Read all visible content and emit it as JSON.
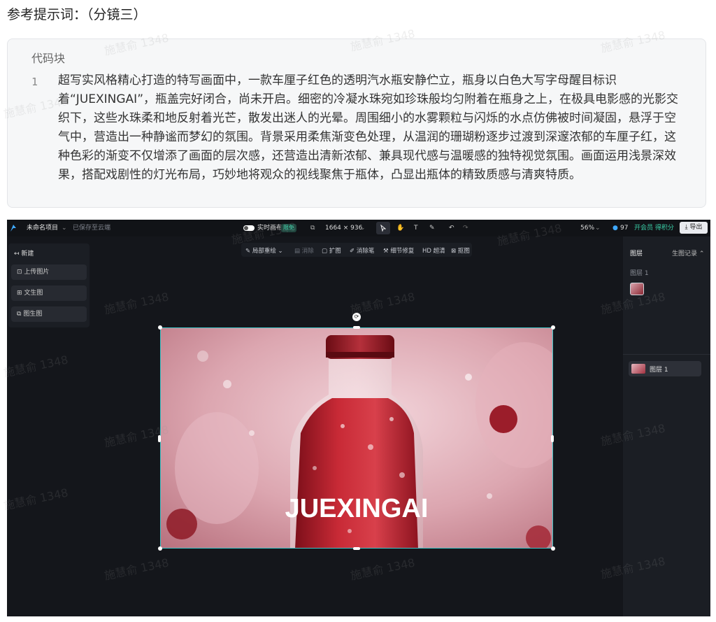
{
  "heading": "参考提示词：（分镜三）",
  "code_block": {
    "label": "代码块",
    "line_number": "1",
    "text": "超写实风格精心打造的特写画面中，一款车厘子红色的透明汽水瓶安静伫立，瓶身以白色大写字母醒目标识着“JUEXINGAI”，瓶盖完好闭合，尚未开启。细密的冷凝水珠宛如珍珠般均匀附着在瓶身之上，在极具电影感的光影交织下，这些水珠柔和地反射着光芒，散发出迷人的光晕。周围细小的水雾颗粒与闪烁的水点仿佛被时间凝固，悬浮于空气中，营造出一种静谧而梦幻的氛围。背景采用柔焦渐变色处理，从温润的珊瑚粉逐步过渡到深邃浓郁的车厘子红，这种色彩的渐变不仅增添了画面的层次感，还营造出清新浓郁、兼具现代感与温暖感的独特视觉氛围。画面运用浅景深效果，搭配戏剧性的灯光布局，巧妙地将观众的视线聚焦于瓶体，凸显出瓶体的精致质感与清爽特质。"
  },
  "watermark": "施慧俞 1348",
  "editor": {
    "topbar": {
      "project_name": "未命名项目",
      "save_status": "已保存至云端",
      "live_canvas": "实时画布",
      "live_badge": "限免",
      "canvas_size": "1664 × 936",
      "zoom": "56%",
      "credits": "97",
      "upgrade": "开会员 得积分",
      "export": "导出"
    },
    "left_panel": {
      "new_label": "新建",
      "buttons": [
        "上传图片",
        "文生图",
        "图生图"
      ]
    },
    "sub_toolbar": {
      "items": [
        "局部重绘",
        "消除",
        "扩图",
        "消除笔",
        "细节修复",
        "HD 超清",
        "抠图"
      ]
    },
    "canvas": {
      "bottle_text": "JUEXINGAI"
    },
    "right_panel": {
      "tab_layers": "图层",
      "tab_history": "生图记录",
      "layer_group": "图层 1",
      "layer_item": "图层 1"
    }
  },
  "colors": {
    "accent": "#3fc4c7",
    "live_badge": "#3ad0a8",
    "bottle_red": "#c1242f"
  }
}
